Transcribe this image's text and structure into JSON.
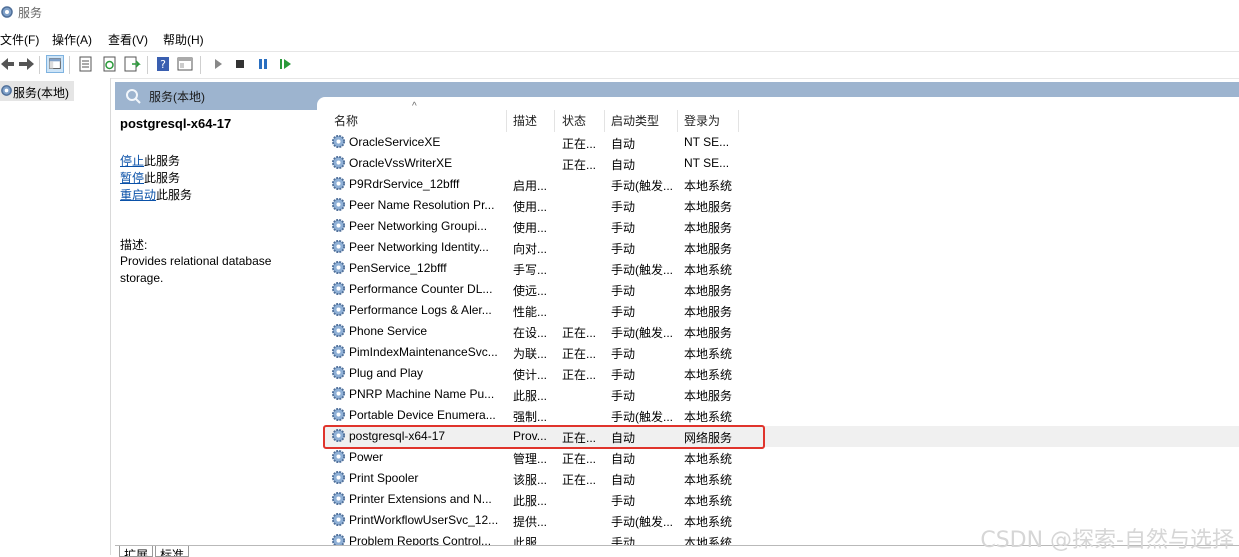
{
  "window": {
    "title": "服务"
  },
  "menu": [
    "文件(F)",
    "操作(A)",
    "查看(V)",
    "帮助(H)"
  ],
  "tree": {
    "root_label": "服务(本地)"
  },
  "panel": {
    "title": "服务(本地)"
  },
  "detail": {
    "service_name": "postgresql-x64-17",
    "actions": [
      {
        "link": "停止",
        "suffix": "此服务"
      },
      {
        "link": "暂停",
        "suffix": "此服务"
      },
      {
        "link": "重启动",
        "suffix": "此服务"
      }
    ],
    "desc_label": "描述:",
    "desc_text": "Provides relational database storage."
  },
  "columns": {
    "name": "名称",
    "desc": "描述",
    "status": "状态",
    "startup": "启动类型",
    "logon": "登录为"
  },
  "rows": [
    {
      "name": "OracleServiceXE",
      "desc": "",
      "status": "正在...",
      "startup": "自动",
      "logon": "NT SE..."
    },
    {
      "name": "OracleVssWriterXE",
      "desc": "",
      "status": "正在...",
      "startup": "自动",
      "logon": "NT SE..."
    },
    {
      "name": "P9RdrService_12bfff",
      "desc": "启用...",
      "status": "",
      "startup": "手动(触发...",
      "logon": "本地系统"
    },
    {
      "name": "Peer Name Resolution Pr...",
      "desc": "使用...",
      "status": "",
      "startup": "手动",
      "logon": "本地服务"
    },
    {
      "name": "Peer Networking Groupi...",
      "desc": "使用...",
      "status": "",
      "startup": "手动",
      "logon": "本地服务"
    },
    {
      "name": "Peer Networking Identity...",
      "desc": "向对...",
      "status": "",
      "startup": "手动",
      "logon": "本地服务"
    },
    {
      "name": "PenService_12bfff",
      "desc": "手写...",
      "status": "",
      "startup": "手动(触发...",
      "logon": "本地系统"
    },
    {
      "name": "Performance Counter DL...",
      "desc": "使远...",
      "status": "",
      "startup": "手动",
      "logon": "本地服务"
    },
    {
      "name": "Performance Logs & Aler...",
      "desc": "性能...",
      "status": "",
      "startup": "手动",
      "logon": "本地服务"
    },
    {
      "name": "Phone Service",
      "desc": "在设...",
      "status": "正在...",
      "startup": "手动(触发...",
      "logon": "本地服务"
    },
    {
      "name": "PimIndexMaintenanceSvc...",
      "desc": "为联...",
      "status": "正在...",
      "startup": "手动",
      "logon": "本地系统"
    },
    {
      "name": "Plug and Play",
      "desc": "使计...",
      "status": "正在...",
      "startup": "手动",
      "logon": "本地系统"
    },
    {
      "name": "PNRP Machine Name Pu...",
      "desc": "此服...",
      "status": "",
      "startup": "手动",
      "logon": "本地服务"
    },
    {
      "name": "Portable Device Enumera...",
      "desc": "强制...",
      "status": "",
      "startup": "手动(触发...",
      "logon": "本地系统"
    },
    {
      "name": "postgresql-x64-17",
      "desc": "Prov...",
      "status": "正在...",
      "startup": "自动",
      "logon": "网络服务"
    },
    {
      "name": "Power",
      "desc": "管理...",
      "status": "正在...",
      "startup": "自动",
      "logon": "本地系统"
    },
    {
      "name": "Print Spooler",
      "desc": "该服...",
      "status": "正在...",
      "startup": "自动",
      "logon": "本地系统"
    },
    {
      "name": "Printer Extensions and N...",
      "desc": "此服...",
      "status": "",
      "startup": "手动",
      "logon": "本地系统"
    },
    {
      "name": "PrintWorkflowUserSvc_12...",
      "desc": "提供...",
      "status": "",
      "startup": "手动(触发...",
      "logon": "本地系统"
    },
    {
      "name": "Problem Reports Control...",
      "desc": "此服...",
      "status": "",
      "startup": "手动",
      "logon": "本地系统"
    }
  ],
  "highlight_color": "#e0342c",
  "bottom_tabs": [
    "扩展",
    "标准"
  ],
  "watermark": "CSDN @探索-自然与选择"
}
